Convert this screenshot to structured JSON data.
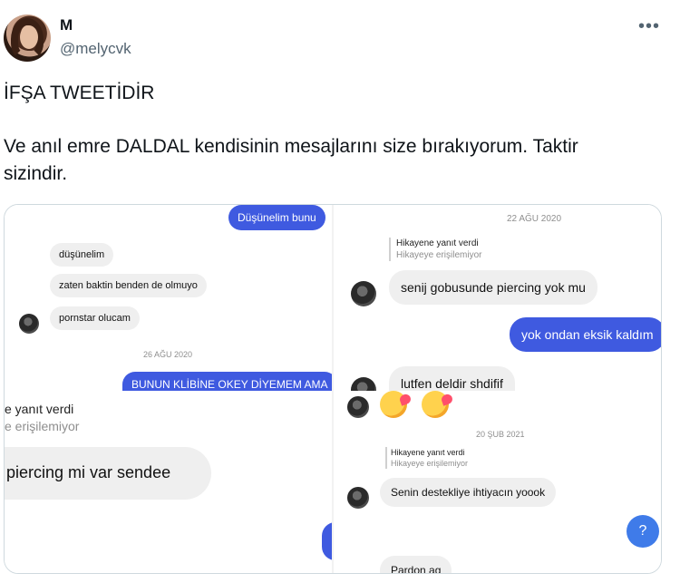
{
  "author": {
    "name": "M",
    "handle": "@melycvk"
  },
  "tweet": {
    "line1": "İFŞA TWEETİDİR",
    "line2": "Ve anıl emre DALDAL kendisinin mesajlarını size bırakıyorum. Taktir sizindir."
  },
  "more_icon": "more-horizontal-icon",
  "screenshots": {
    "top_left": {
      "out_top": "Düşünelim bunu",
      "in_messages": [
        "düşünelim",
        "zaten baktin benden de olmuyo",
        "pornstar olucam"
      ],
      "date": "26 AĞU 2020",
      "out_bottom": "BUNUN KLİBİNE OKEY DİYEMEM AMA"
    },
    "top_right": {
      "date": "22 AĞU 2020",
      "reply_label": "Hikayene yanıt verdi",
      "reply_sub": "Hikayeye erişilemiyor",
      "in_1": "senij gobusunde piercing yok mu",
      "out_1": "yok ondan eksik kaldım",
      "in_2": "lutfen deldir shdifif"
    },
    "bottom_left": {
      "reply_label": "e yanıt verdi",
      "reply_sub": "e erişilemiyor",
      "in_1": "piercing mi var sendee"
    },
    "bottom_right": {
      "date": "20 ŞUB 2021",
      "reply_label": "Hikayene yanıt verdi",
      "reply_sub": "Hikayeye erişilemiyor",
      "in_1": "Senin destekliye ihtiyacın yoook",
      "in_2": "Pardon ag",
      "help": "?"
    }
  }
}
